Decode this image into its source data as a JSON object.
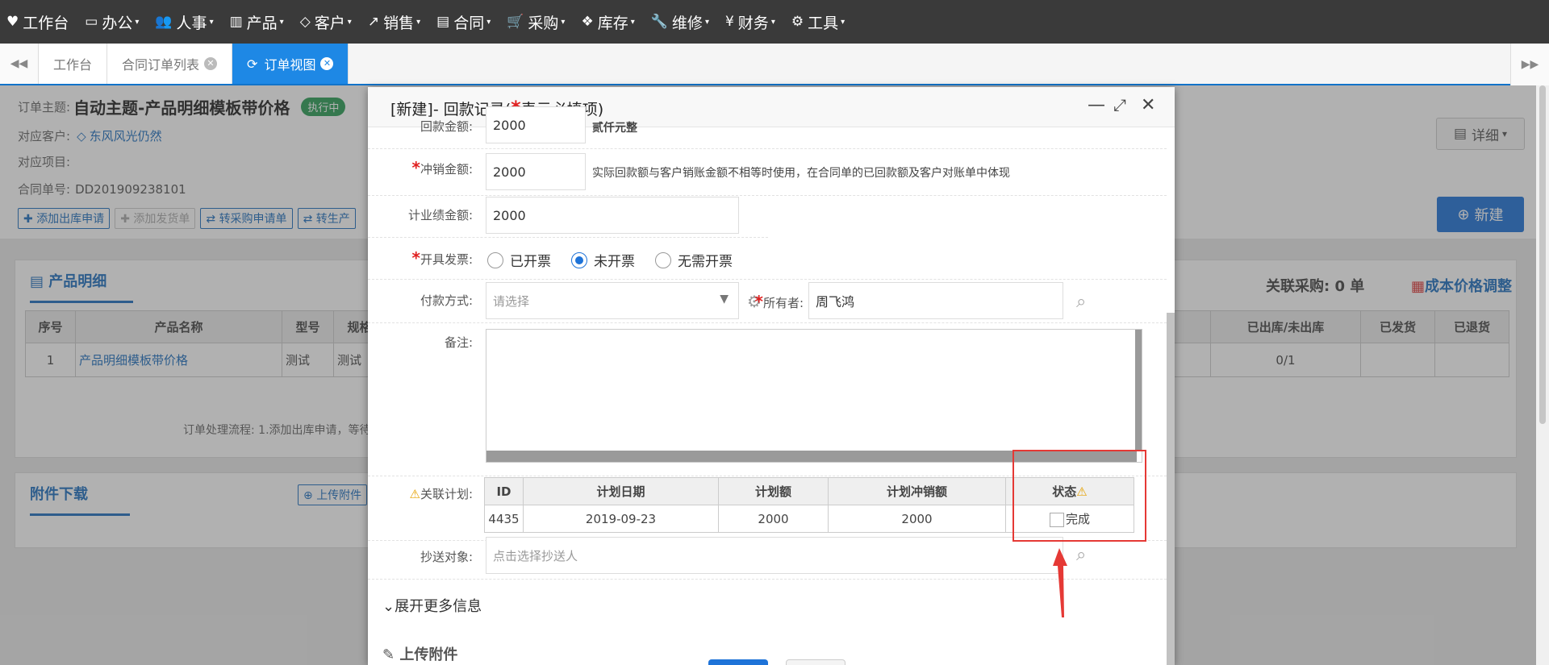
{
  "topnav": {
    "items": [
      {
        "icon": "heart-icon",
        "glyph": "♥",
        "label": "工作台",
        "caret": ""
      },
      {
        "icon": "laptop-icon",
        "glyph": "▭",
        "label": "办公",
        "caret": "▾"
      },
      {
        "icon": "users-icon",
        "glyph": "👥",
        "label": "人事",
        "caret": "▾"
      },
      {
        "icon": "barcode-icon",
        "glyph": "▥",
        "label": "产品",
        "caret": "▾"
      },
      {
        "icon": "diamond-icon",
        "glyph": "◇",
        "label": "客户",
        "caret": "▾"
      },
      {
        "icon": "line-chart-icon",
        "glyph": "↗",
        "label": "销售",
        "caret": "▾"
      },
      {
        "icon": "contract-icon",
        "glyph": "▤",
        "label": "合同",
        "caret": "▾"
      },
      {
        "icon": "cart-icon",
        "glyph": "🛒",
        "label": "采购",
        "caret": "▾"
      },
      {
        "icon": "cubes-icon",
        "glyph": "❖",
        "label": "库存",
        "caret": "▾"
      },
      {
        "icon": "wrench-icon",
        "glyph": "🔧",
        "label": "维修",
        "caret": "▾"
      },
      {
        "icon": "yen-icon",
        "glyph": "¥",
        "label": "财务",
        "caret": "▾"
      },
      {
        "icon": "gear-icon",
        "glyph": "⚙",
        "label": "工具",
        "caret": "▾"
      }
    ]
  },
  "tabs": {
    "items": [
      {
        "label": "工作台"
      },
      {
        "label": "合同订单列表"
      },
      {
        "label": "订单视图"
      }
    ],
    "close_glyph": "✕",
    "refresh_glyph": "⟳",
    "left_arrow": "◀◀",
    "right_arrow": "▶▶"
  },
  "order": {
    "subject_key": "订单主题:",
    "subject": "自动主题-产品明细模板带价格",
    "status_badge": "执行中",
    "customer_key": "对应客户:",
    "customer": "东风风光仍然",
    "project_key": "对应项目:",
    "number_key": "合同单号:",
    "number": "DD201909238101",
    "actions": [
      "添加出库申请",
      "添加发货单",
      "转采购申请单",
      "转生产"
    ],
    "detail_btn": "详细",
    "new_btn": "新建"
  },
  "products": {
    "title": "产品明细",
    "purchase_link": "关联采购: 0 单",
    "cost_link": "成本价格调整",
    "headers": [
      "序号",
      "产品名称",
      "型号",
      "规格",
      "已出库/未出库",
      "已发货",
      "已退货"
    ],
    "rows": [
      [
        "1",
        "产品明细模板带价格",
        "测试",
        "测试",
        "0/1",
        "",
        ""
      ]
    ],
    "process": "订单处理流程: 1.添加出库申请，等待"
  },
  "attachments": {
    "title": "附件下载",
    "upload_btn": "上传附件"
  },
  "modal": {
    "title_prefix": "[新建]- 回款记录(",
    "title_star": "*",
    "title_suffix": "表示必填项)",
    "min_glyph": "—",
    "max_glyph": "⤢",
    "close_glyph": "✕",
    "fields": {
      "huikuan_label": "回款金额:",
      "huikuan_value": "2000",
      "huikuan_words": "贰仟元整",
      "chongxiao_label": "冲销金额:",
      "chongxiao_value": "2000",
      "chongxiao_note": "实际回款额与客户销账金额不相等时使用，在合同单的已回款额及客户对账单中体现",
      "yeji_label": "计业绩金额:",
      "yeji_value": "2000",
      "fapiao_label": "开具发票:",
      "fapiao_options": [
        "已开票",
        "未开票",
        "无需开票"
      ],
      "fapiao_selected": "未开票",
      "fukuan_label": "付款方式:",
      "fukuan_placeholder": "请选择",
      "owner_label": "所有者:",
      "owner_value": "周飞鸿",
      "beizhu_label": "备注:",
      "plan_label": "关联计划:",
      "chaosong_label": "抄送对象:",
      "chaosong_placeholder": "点击选择抄送人"
    },
    "plan_table": {
      "headers": [
        "ID",
        "计划日期",
        "计划额",
        "计划冲销额",
        "状态"
      ],
      "rows": [
        [
          "4435",
          "2019-09-23",
          "2000",
          "2000",
          "完成"
        ]
      ]
    },
    "expand_more": "展开更多信息",
    "upload_more": "上传附件"
  }
}
